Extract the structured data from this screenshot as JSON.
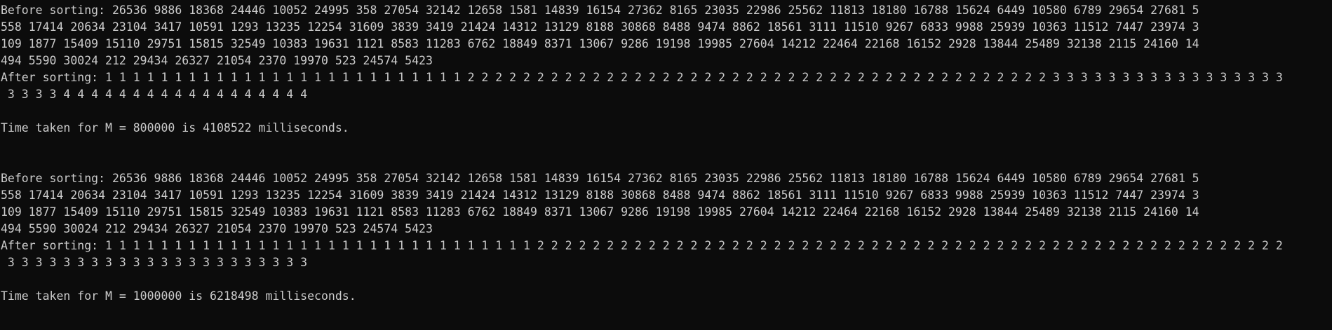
{
  "console": {
    "lines": [
      "Before sorting: 26536 9886 18368 24446 10052 24995 358 27054 32142 12658 1581 14839 16154 27362 8165 23035 22986 25562 11813 18180 16788 15624 6449 10580 6789 29654 27681 5",
      "558 17414 20634 23104 3417 10591 1293 13235 12254 31609 3839 3419 21424 14312 13129 8188 30868 8488 9474 8862 18561 3111 11510 9267 6833 9988 25939 10363 11512 7447 23974 3",
      "109 1877 15409 15110 29751 15815 32549 10383 19631 1121 8583 11283 6762 18849 8371 13067 9286 19198 19985 27604 14212 22464 22168 16152 2928 13844 25489 32138 2115 24160 14",
      "494 5590 30024 212 29434 26327 21054 2370 19970 523 24574 5423",
      "After sorting: 1 1 1 1 1 1 1 1 1 1 1 1 1 1 1 1 1 1 1 1 1 1 1 1 1 1 2 2 2 2 2 2 2 2 2 2 2 2 2 2 2 2 2 2 2 2 2 2 2 2 2 2 2 2 2 2 2 2 2 2 2 2 2 2 2 2 2 2 3 3 3 3 3 3 3 3 3 3 3 3 3 3 3 3 3",
      " 3 3 3 3 4 4 4 4 4 4 4 4 4 4 4 4 4 4 4 4 4 4",
      "",
      "Time taken for M = 800000 is 4108522 milliseconds.",
      "",
      "",
      "Before sorting: 26536 9886 18368 24446 10052 24995 358 27054 32142 12658 1581 14839 16154 27362 8165 23035 22986 25562 11813 18180 16788 15624 6449 10580 6789 29654 27681 5",
      "558 17414 20634 23104 3417 10591 1293 13235 12254 31609 3839 3419 21424 14312 13129 8188 30868 8488 9474 8862 18561 3111 11510 9267 6833 9988 25939 10363 11512 7447 23974 3",
      "109 1877 15409 15110 29751 15815 32549 10383 19631 1121 8583 11283 6762 18849 8371 13067 9286 19198 19985 27604 14212 22464 22168 16152 2928 13844 25489 32138 2115 24160 14",
      "494 5590 30024 212 29434 26327 21054 2370 19970 523 24574 5423",
      "After sorting: 1 1 1 1 1 1 1 1 1 1 1 1 1 1 1 1 1 1 1 1 1 1 1 1 1 1 1 1 1 1 1 2 2 2 2 2 2 2 2 2 2 2 2 2 2 2 2 2 2 2 2 2 2 2 2 2 2 2 2 2 2 2 2 2 2 2 2 2 2 2 2 2 2 2 2 2 2 2 2 2 2 2 2 2 2",
      " 3 3 3 3 3 3 3 3 3 3 3 3 3 3 3 3 3 3 3 3 3 3",
      "",
      "Time taken for M = 1000000 is 6218498 milliseconds."
    ]
  }
}
